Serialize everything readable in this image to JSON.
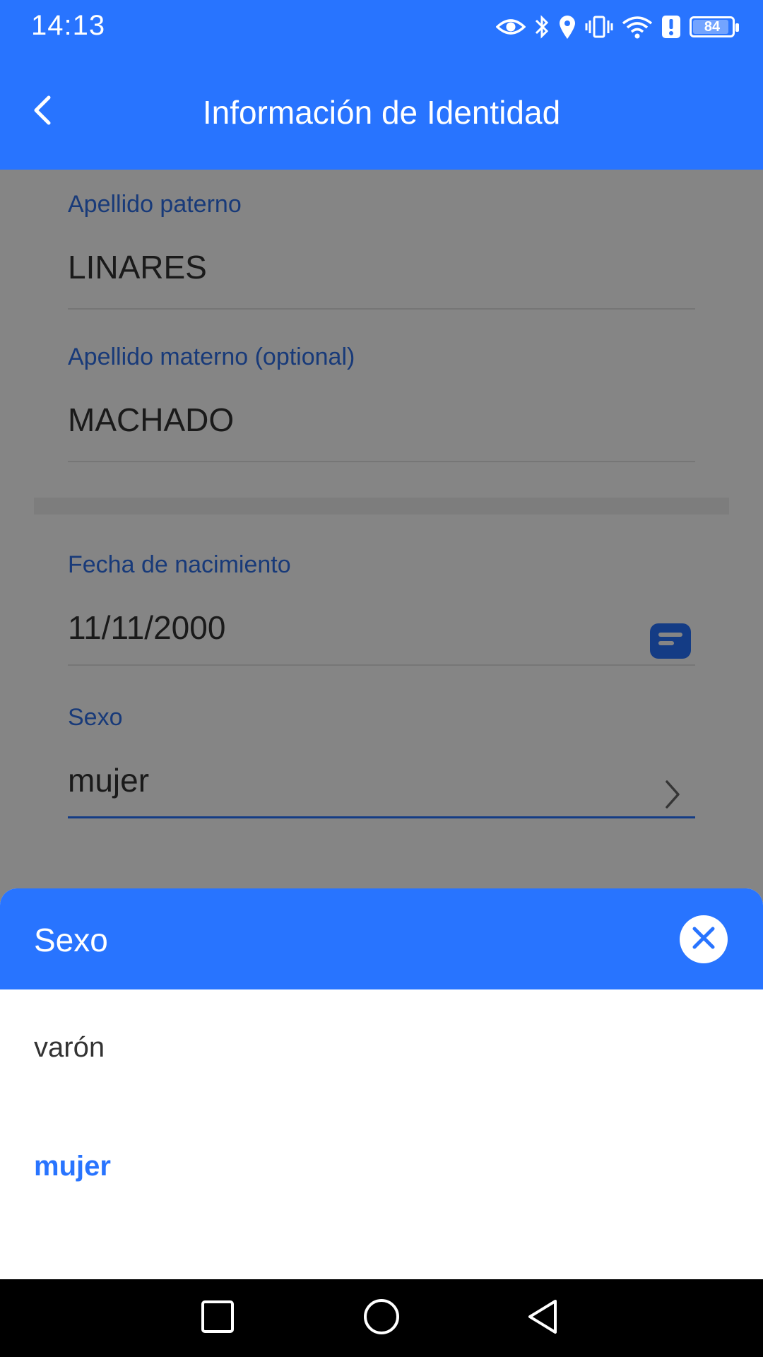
{
  "status_bar": {
    "time": "14:13",
    "battery_level": "84",
    "icons": [
      "eye-icon",
      "bluetooth-icon",
      "location-icon",
      "vibrate-icon",
      "wifi-icon",
      "alert-icon",
      "battery-icon"
    ]
  },
  "header": {
    "title": "Información de Identidad",
    "back_icon": "chevron-left-icon"
  },
  "form": {
    "paternal_surname": {
      "label": "Apellido paterno",
      "value": "LINARES"
    },
    "maternal_surname": {
      "label": "Apellido materno (optional)",
      "value": "MACHADO"
    },
    "birth_date": {
      "label": "Fecha de nacimiento",
      "value": "11/11/2000",
      "icon": "calendar-icon"
    },
    "sex": {
      "label": "Sexo",
      "value": "mujer",
      "icon": "chevron-right-icon"
    }
  },
  "sheet": {
    "title": "Sexo",
    "close_icon": "close-icon",
    "options": [
      {
        "label": "varón",
        "selected": false
      },
      {
        "label": "mujer",
        "selected": true
      }
    ]
  },
  "nav_bar": {
    "icons": [
      "recents-square-icon",
      "home-circle-icon",
      "back-triangle-icon"
    ]
  },
  "colors": {
    "primary": "#2874ff",
    "label_blue": "#2e6fe8",
    "text": "#333333",
    "overlay": "rgba(0,0,0,0.48)"
  }
}
